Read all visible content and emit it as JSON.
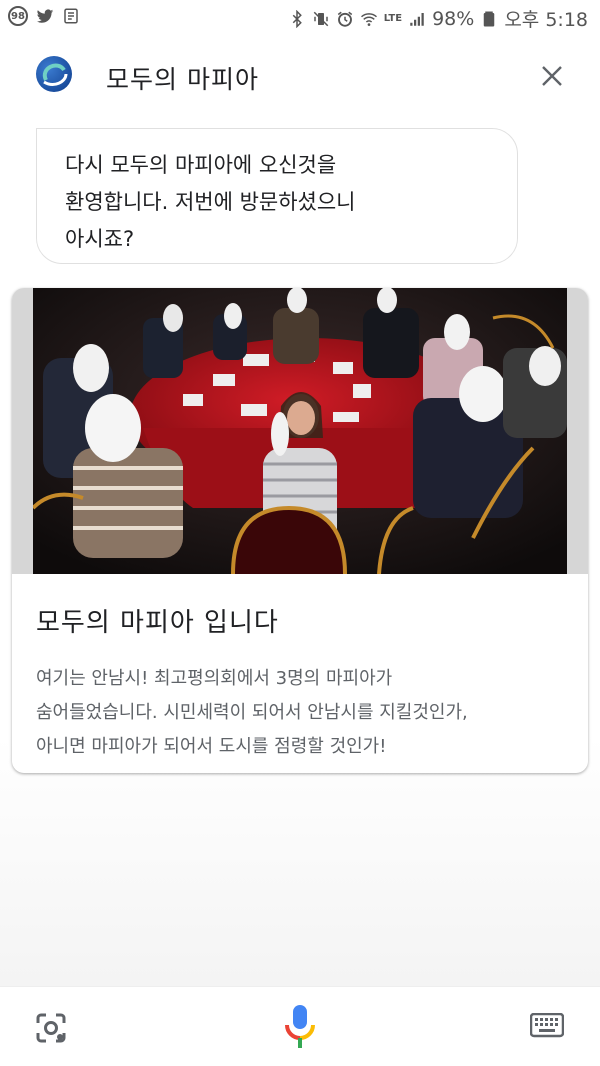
{
  "status_bar": {
    "notification_badge": "98",
    "network": "LTE",
    "battery": "98%",
    "time": "오후 5:18"
  },
  "header": {
    "title": "모두의 마피아"
  },
  "message": {
    "text": "다시 모두의 마피아에 오신것을\n환영합니다. 저번에 방문하셨으니\n아시죠?"
  },
  "card": {
    "image_icon": "mafia-game-photo",
    "title": "모두의 마피아 입니다",
    "description": "여기는 안남시! 최고평의회에서 3명의 마피아가\n숨어들었습니다. 시민세력이 되어서 안남시를 지킬것인가,\n아니면 마피아가 되어서 도시를 점령할 것인가!"
  },
  "bottom_bar": {
    "lens_icon": "lens-icon",
    "mic_icon": "mic-icon",
    "keyboard_icon": "keyboard-icon"
  },
  "colors": {
    "mic_blue": "#4285F4",
    "mic_red": "#EA4335",
    "mic_yellow": "#FBBC05",
    "mic_green": "#34A853",
    "table_red": "#b3121c"
  }
}
